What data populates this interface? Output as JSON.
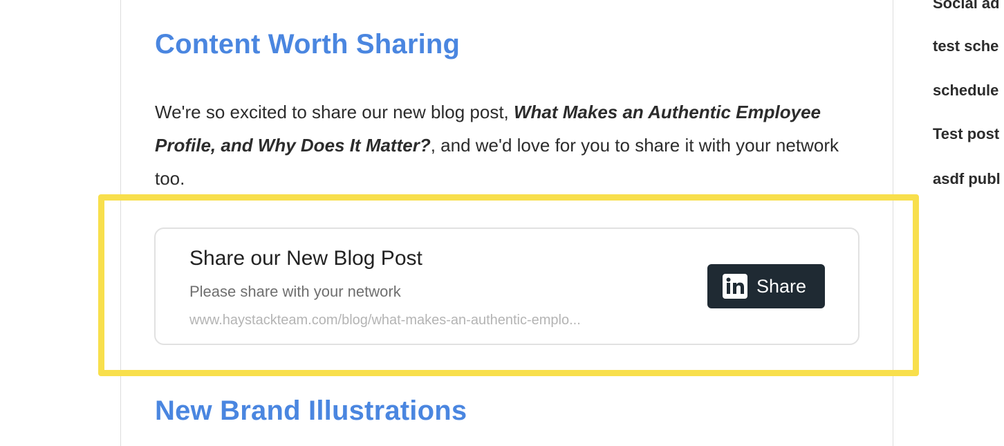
{
  "main": {
    "heading_top": "Content Worth Sharing",
    "intro": {
      "before": "We're so excited to share our new blog post, ",
      "emphasis": "What Makes an Authentic Employee Profile, and Why Does It Matter?",
      "after": ", and we'd love for you to share it with your network too."
    },
    "share_card": {
      "title": "Share our New Blog Post",
      "subtitle": "Please share with your network",
      "url": "www.haystackteam.com/blog/what-makes-an-authentic-emplo...",
      "button_label": "Share",
      "button_icon": "linkedin-icon"
    },
    "heading_bottom": "New Brand Illustrations"
  },
  "sidebar": {
    "items": [
      {
        "label": "Social ad"
      },
      {
        "label": "test sche"
      },
      {
        "label": "schedule"
      },
      {
        "label": "Test post"
      },
      {
        "label": "asdf publ"
      }
    ]
  },
  "colors": {
    "heading": "#4a86e0",
    "highlight_border": "#f8df4c",
    "share_button_bg": "#1f2a33"
  }
}
